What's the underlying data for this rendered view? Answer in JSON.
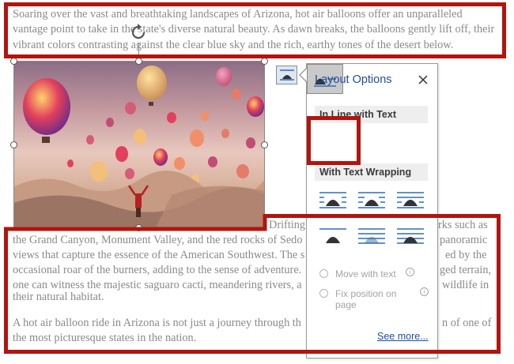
{
  "document": {
    "paragraph1": "Soaring over the vast and breathtaking landscapes of Arizona, hot air balloons offer an unparalleled vantage point to take in the state's diverse natural beauty. As dawn breaks, the balloons gently lift off, their vibrant colors contrasting against the clear blue sky and the rich, earthy tones of the desert below.",
    "paragraph2_left_lines": [
      "",
      "the Grand Canyon, Monument Valley, and the red rocks of Sedo",
      "views that capture the essence of the American Southwest. The s",
      "occasional roar of the burners, adding to the sense of adventure.",
      "one can witness the majestic saguaro cacti, meandering rivers, a",
      "their natural habitat."
    ],
    "paragraph2_right_lines": [
      "Drifting s",
      "rks such as",
      "panoramic",
      "ed by the",
      "ged terrain,",
      "wildlife in"
    ],
    "paragraph3_left": "A hot air balloon ride in Arizona is not just a journey through th",
    "paragraph3_right": "n of one of",
    "paragraph3_line2": "the most picturesque states in the nation."
  },
  "layout_options": {
    "title": "Layout Options",
    "section_inline": "In Line with Text",
    "section_wrap": "With Text Wrapping",
    "move_with_text": "Move with text",
    "fix_position_line1": "Fix position on",
    "fix_position_line2": "page",
    "see_more": "See more..."
  },
  "icons": {
    "layout_trigger": "layout-options-icon",
    "close": "close-icon",
    "rotate": "rotate-handle-icon",
    "info": "info-icon"
  },
  "colors": {
    "highlight": "#b3140e",
    "panel_title": "#1f4e9a",
    "text_gray": "#8a8a8a"
  }
}
